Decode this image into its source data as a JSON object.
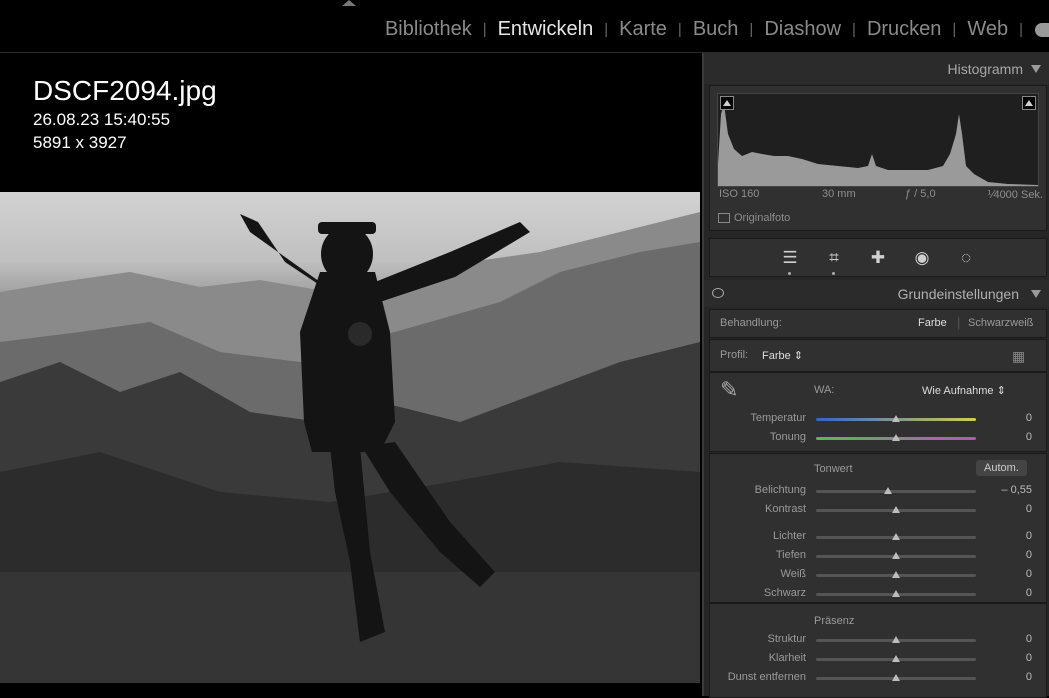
{
  "modules": [
    "Bibliothek",
    "Entwickeln",
    "Karte",
    "Buch",
    "Diashow",
    "Drucken",
    "Web"
  ],
  "active_module": "Entwickeln",
  "image_info": {
    "filename": "DSCF2094.jpg",
    "datetime": "26.08.23 15:40:55",
    "dimensions": "5891 x 3927"
  },
  "histogram": {
    "title": "Histogramm",
    "iso": "ISO 160",
    "focal": "30 mm",
    "aperture": "ƒ / 5,0",
    "shutter": "⅟4000 Sek.",
    "original_label": "Originalfoto"
  },
  "tool_icons": [
    "sliders-icon",
    "crop-icon",
    "healing-icon",
    "redeye-icon",
    "masking-icon"
  ],
  "basic": {
    "title": "Grundeinstellungen",
    "treatment_label": "Behandlung:",
    "treatment_color": "Farbe",
    "treatment_bw": "Schwarzweiß",
    "profile_label": "Profil:",
    "profile_value": "Farbe",
    "wb_label": "WA:",
    "wb_value": "Wie Aufnahme",
    "tone_label": "Tonwert",
    "auto_label": "Autom.",
    "presence_label": "Präsenz"
  },
  "sliders_wb": [
    {
      "label": "Temperatur",
      "value": "0",
      "pos": 0.5
    },
    {
      "label": "Tonung",
      "value": "0",
      "pos": 0.5
    }
  ],
  "sliders_tone1": [
    {
      "label": "Belichtung",
      "value": "– 0,55",
      "pos": 0.45
    },
    {
      "label": "Kontrast",
      "value": "0",
      "pos": 0.5
    }
  ],
  "sliders_tone2": [
    {
      "label": "Lichter",
      "value": "0",
      "pos": 0.5
    },
    {
      "label": "Tiefen",
      "value": "0",
      "pos": 0.5
    },
    {
      "label": "Weiß",
      "value": "0",
      "pos": 0.5
    },
    {
      "label": "Schwarz",
      "value": "0",
      "pos": 0.5
    }
  ],
  "sliders_presence": [
    {
      "label": "Struktur",
      "value": "0",
      "pos": 0.5
    },
    {
      "label": "Klarheit",
      "value": "0",
      "pos": 0.5
    },
    {
      "label": "Dunst entfernen",
      "value": "0",
      "pos": 0.5
    }
  ]
}
